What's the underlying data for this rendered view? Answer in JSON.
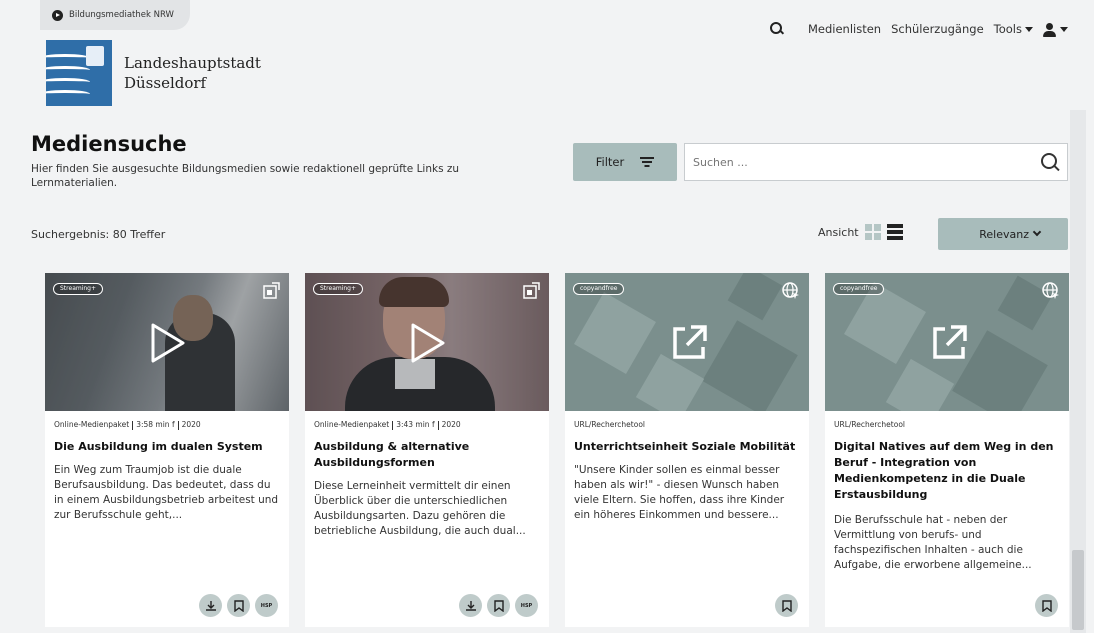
{
  "header": {
    "portal_badge": "Bildungsmediathek NRW",
    "logo_line1": "Landeshauptstadt",
    "logo_line2": "Düsseldorf",
    "nav": {
      "medienlisten": "Medienlisten",
      "schuelerzugaenge": "Schülerzugänge",
      "tools": "Tools"
    }
  },
  "main": {
    "title": "Mediensuche",
    "description": "Hier finden Sie ausgesuchte Bildungsmedien sowie redaktionell geprüfte Links zu Lernmaterialien.",
    "filter_label": "Filter",
    "search_placeholder": "Suchen ...",
    "result_count": "Suchergebnis: 80 Treffer",
    "view_label": "Ansicht",
    "sort_label": "Relevanz"
  },
  "cards": [
    {
      "tag": "Streaming+",
      "meta": [
        "Online-Medienpaket",
        "3:58 min f",
        "2020"
      ],
      "title": "Die Ausbildung im dualen System",
      "description": "Ein Weg zum Traumjob ist die duale Berufsausbildung. Das bedeutet, dass du in einem Ausbildungsbetrieb arbeitest und zur Berufsschule geht,...",
      "hsp_label": "HSP"
    },
    {
      "tag": "Streaming+",
      "meta": [
        "Online-Medienpaket",
        "3:43 min f",
        "2020"
      ],
      "title": "Ausbildung & alternative Ausbildungsformen",
      "description": "Diese Lerneinheit vermittelt dir einen Überblick über die unterschiedlichen Ausbildungsarten. Dazu gehören die betriebliche Ausbildung, die auch dual...",
      "hsp_label": "HSP"
    },
    {
      "tag": "copyandfree",
      "meta": [
        "URL/Recherchetool"
      ],
      "title": "Unterrichtseinheit Soziale Mobilität",
      "description": "\"Unsere Kinder sollen es einmal besser haben als wir!\" - diesen Wunsch haben viele Eltern. Sie hoffen, dass ihre Kinder ein höheres Einkommen und bessere..."
    },
    {
      "tag": "copyandfree",
      "meta": [
        "URL/Recherchetool"
      ],
      "title": "Digital Natives auf dem Weg in den Beruf - Integration von Medienkompetenz in die Duale Erstausbildung",
      "description": "Die Berufsschule hat - neben der Vermittlung von berufs- und fachspezifischen Inhalten - auch die Aufgabe, die erworbene allgemeine..."
    }
  ],
  "colors": {
    "accent_button": "#a8bcbb",
    "action_circle": "#bfcbca",
    "page_bg": "#f2f3f4"
  }
}
